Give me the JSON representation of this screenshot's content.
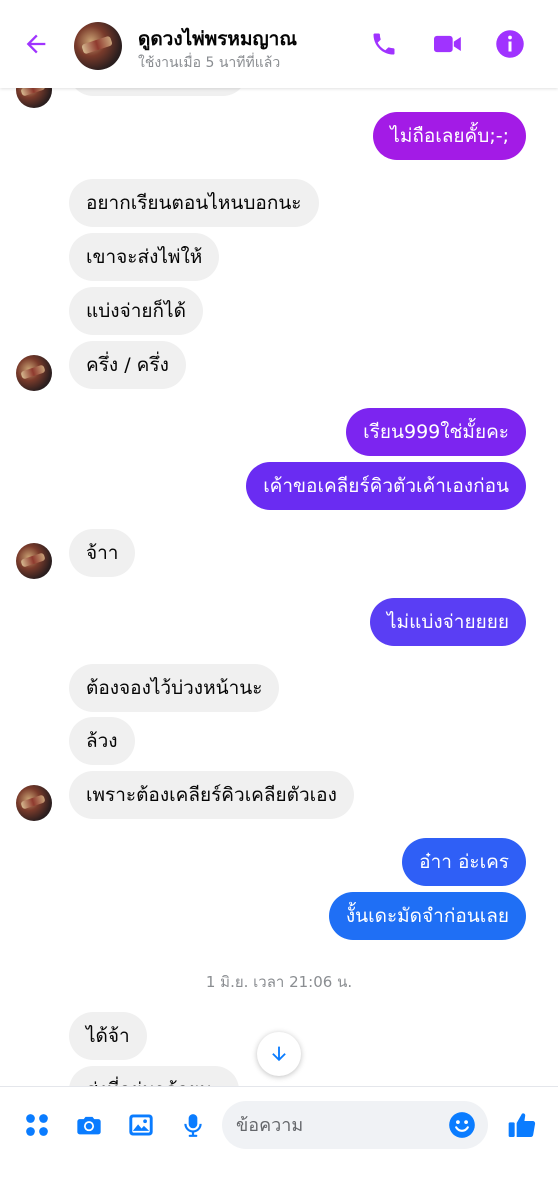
{
  "header": {
    "contact_name": "ดูดวงไพ่พรหมญาณ",
    "status": "ใช้งานเมื่อ 5 นาทีที่แล้ว",
    "accent_color": "#a033ff"
  },
  "messages": [
    {
      "side": "out",
      "text": "ไม่ถือเลยคั้บ;-;",
      "color": "#a31be6"
    },
    {
      "side": "in",
      "text": "อยากเรียนตอนไหนบอกนะ"
    },
    {
      "side": "in",
      "text": "เขาจะส่งไพ่ให้"
    },
    {
      "side": "in",
      "text": "แบ่งจ่ายก็ได้"
    },
    {
      "side": "in",
      "text": "ครึ่ง / ครึ่ง"
    },
    {
      "side": "out",
      "text": "เรียน999ใช่มั้ยคะ",
      "color": "#7c25f0"
    },
    {
      "side": "out",
      "text": "เค้าขอเคลียร์คิวตัวเค้าเองก่อน",
      "color": "#6a2cf2"
    },
    {
      "side": "in",
      "text": "จ้าา"
    },
    {
      "side": "out",
      "text": "ไม่แบ่งจ่ายยยย",
      "color": "#5a3ef4"
    },
    {
      "side": "in",
      "text": "ต้องจองไว้บ่วงหน้านะ"
    },
    {
      "side": "in",
      "text": "ล้วง"
    },
    {
      "side": "in",
      "text": "เพราะต้องเคลียร์คิวเคลียตัวเอง"
    },
    {
      "side": "out",
      "text": "อ๋าา อ่ะเคร",
      "color": "#2f5ff6"
    },
    {
      "side": "out",
      "text": "งั้นเดะมัดจำก่อนเลย",
      "color": "#1f6ff5"
    },
    {
      "side": "in",
      "text": "ได้จ้า"
    },
    {
      "side": "in",
      "text": "ส่งที่อยู่มาด้วยนะ"
    }
  ],
  "timestamp": "1 มิ.ย. เวลา 21:06 น.",
  "composer": {
    "placeholder": "ข้อความ",
    "icon_color": "#0a7cff"
  }
}
